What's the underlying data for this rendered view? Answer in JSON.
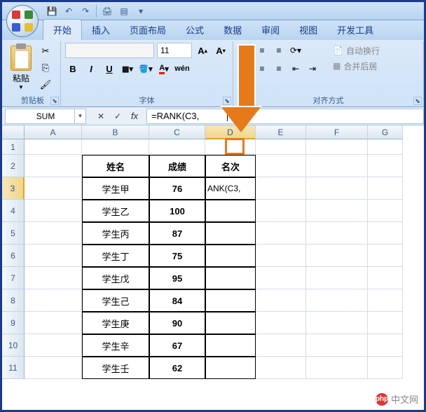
{
  "qat": {
    "save": "💾",
    "undo": "↶",
    "redo": "↷",
    "print": "🖨",
    "more": "▾"
  },
  "tabs": [
    "开始",
    "插入",
    "页面布局",
    "公式",
    "数据",
    "审阅",
    "视图",
    "开发工具"
  ],
  "active_tab": 0,
  "ribbon": {
    "clipboard": {
      "paste": "粘贴",
      "label": "剪贴板"
    },
    "font": {
      "size": "11",
      "label": "字体",
      "cut": "✂",
      "copy": "⎘",
      "format_painter": "🖌"
    },
    "align": {
      "label": "对齐方式",
      "wrap": "自动换行",
      "merge": "合并后居"
    }
  },
  "name_box": "SUM",
  "formula": "=RANK(C3,",
  "columns": [
    "A",
    "B",
    "C",
    "D",
    "E",
    "F",
    "G"
  ],
  "rows": [
    "1",
    "2",
    "3",
    "4",
    "5",
    "6",
    "7",
    "8",
    "9",
    "10",
    "11"
  ],
  "active_row": 3,
  "active_col": "D",
  "table": {
    "headers": [
      "姓名",
      "成绩",
      "名次"
    ],
    "rows": [
      {
        "name": "学生甲",
        "score": "76",
        "rank": "ANK(C3,"
      },
      {
        "name": "学生乙",
        "score": "100",
        "rank": ""
      },
      {
        "name": "学生丙",
        "score": "87",
        "rank": ""
      },
      {
        "name": "学生丁",
        "score": "75",
        "rank": ""
      },
      {
        "name": "学生戊",
        "score": "95",
        "rank": ""
      },
      {
        "name": "学生己",
        "score": "84",
        "rank": ""
      },
      {
        "name": "学生庚",
        "score": "90",
        "rank": ""
      },
      {
        "name": "学生辛",
        "score": "67",
        "rank": ""
      },
      {
        "name": "学生壬",
        "score": "62",
        "rank": ""
      }
    ]
  },
  "watermark": {
    "icon": "php",
    "text": "中文网"
  }
}
